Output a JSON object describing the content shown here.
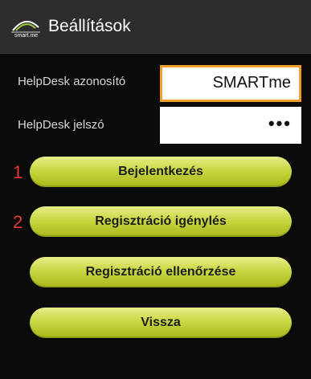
{
  "header": {
    "title": "Beállítások",
    "icon": "smartme-logo-icon",
    "logo_text": "smart.me"
  },
  "form": {
    "username": {
      "label": "HelpDesk azonosító",
      "value": "SMARTme"
    },
    "password": {
      "label": "HelpDesk jelszó",
      "value": "•••"
    }
  },
  "markers": [
    "1",
    "2"
  ],
  "buttons": {
    "login": "Bejelentkezés",
    "request_registration": "Regisztráció igénylés",
    "check_registration": "Regisztráció ellenőrzése",
    "back": "Vissza"
  },
  "colors": {
    "background": "#0b0b0b",
    "titlebar": "#2d2d2d",
    "button": "#c9d743",
    "focus_border": "#f0a028",
    "marker": "#e53935"
  }
}
